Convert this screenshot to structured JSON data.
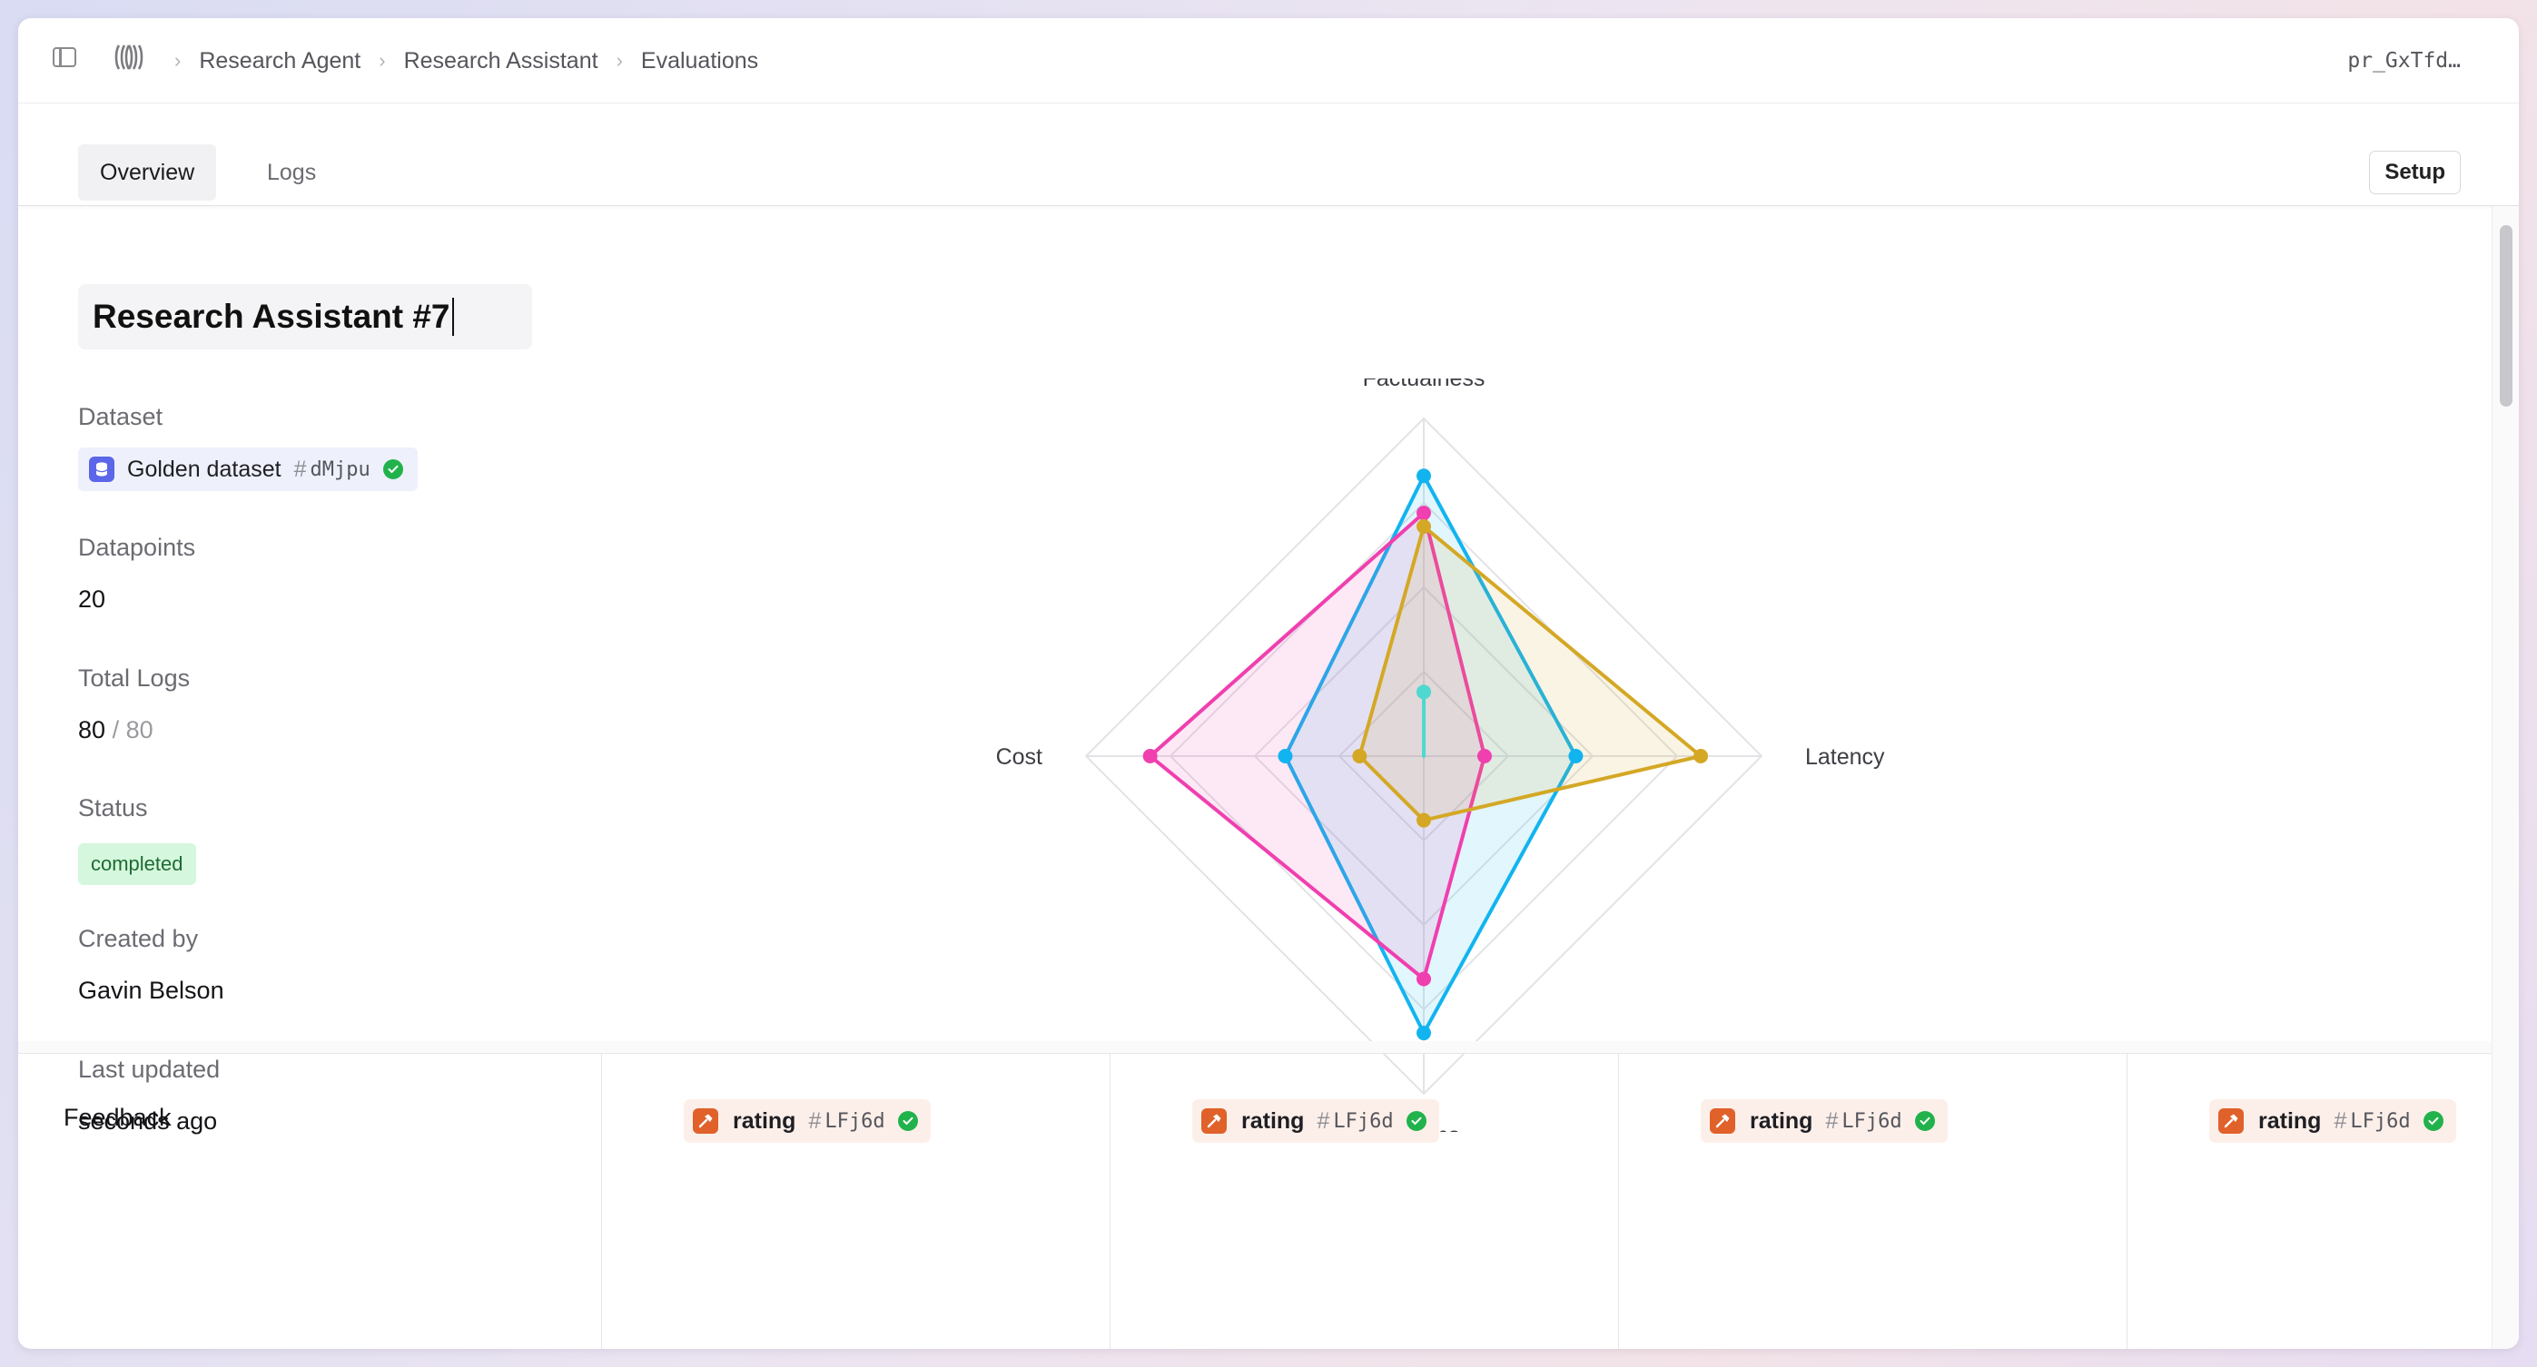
{
  "breadcrumbs": [
    "Research Agent",
    "Research Assistant",
    "Evaluations"
  ],
  "api_key": "pr_GxTfd…",
  "tabs": [
    {
      "label": "Overview",
      "active": true
    },
    {
      "label": "Logs",
      "active": false
    }
  ],
  "setup_label": "Setup",
  "evaluation": {
    "title": "Research Assistant #7",
    "dataset_label": "Dataset",
    "dataset_name": "Golden dataset",
    "dataset_hash": "#",
    "dataset_id": "dMjpu",
    "datapoints_label": "Datapoints",
    "datapoints": "20",
    "total_logs_label": "Total Logs",
    "total_logs": "80",
    "total_logs_of": "/ 80",
    "status_label": "Status",
    "status": "completed",
    "created_by_label": "Created by",
    "created_by": "Gavin Belson",
    "last_updated_label": "Last updated",
    "last_updated": "seconds ago"
  },
  "chart_data": {
    "type": "radar",
    "axes": [
      "Factualness",
      "Latency",
      "Tokens",
      "Cost"
    ],
    "range": [
      0,
      1
    ],
    "rings": 4,
    "series": [
      {
        "color": "#12b4f0",
        "values": [
          0.83,
          0.45,
          0.82,
          0.41
        ]
      },
      {
        "color": "#f03faf",
        "values": [
          0.72,
          0.18,
          0.66,
          0.81
        ]
      },
      {
        "color": "#d4a825",
        "values": [
          0.68,
          0.82,
          0.19,
          0.19
        ]
      },
      {
        "color": "#4fd8cf",
        "values": [
          0.19,
          0.0,
          0.0,
          0.0
        ]
      }
    ]
  },
  "feedback": {
    "label": "Feedback",
    "items": [
      {
        "name": "rating",
        "hash": "#",
        "id": "LFj6d"
      },
      {
        "name": "rating",
        "hash": "#",
        "id": "LFj6d"
      },
      {
        "name": "rating",
        "hash": "#",
        "id": "LFj6d"
      },
      {
        "name": "rating",
        "hash": "#",
        "id": "LFj6d"
      }
    ]
  },
  "colors": {
    "accent_status_bg": "#d5f7dd",
    "dataset_icon": "#5b66e8",
    "rating_icon": "#e0612a",
    "check": "#22b24c"
  },
  "icons": {
    "sidebar_toggle": "sidebar-toggle-icon",
    "logo": "app-logo-icon",
    "dataset": "database-icon",
    "rating": "hammer-icon",
    "check": "check-circle-icon"
  }
}
